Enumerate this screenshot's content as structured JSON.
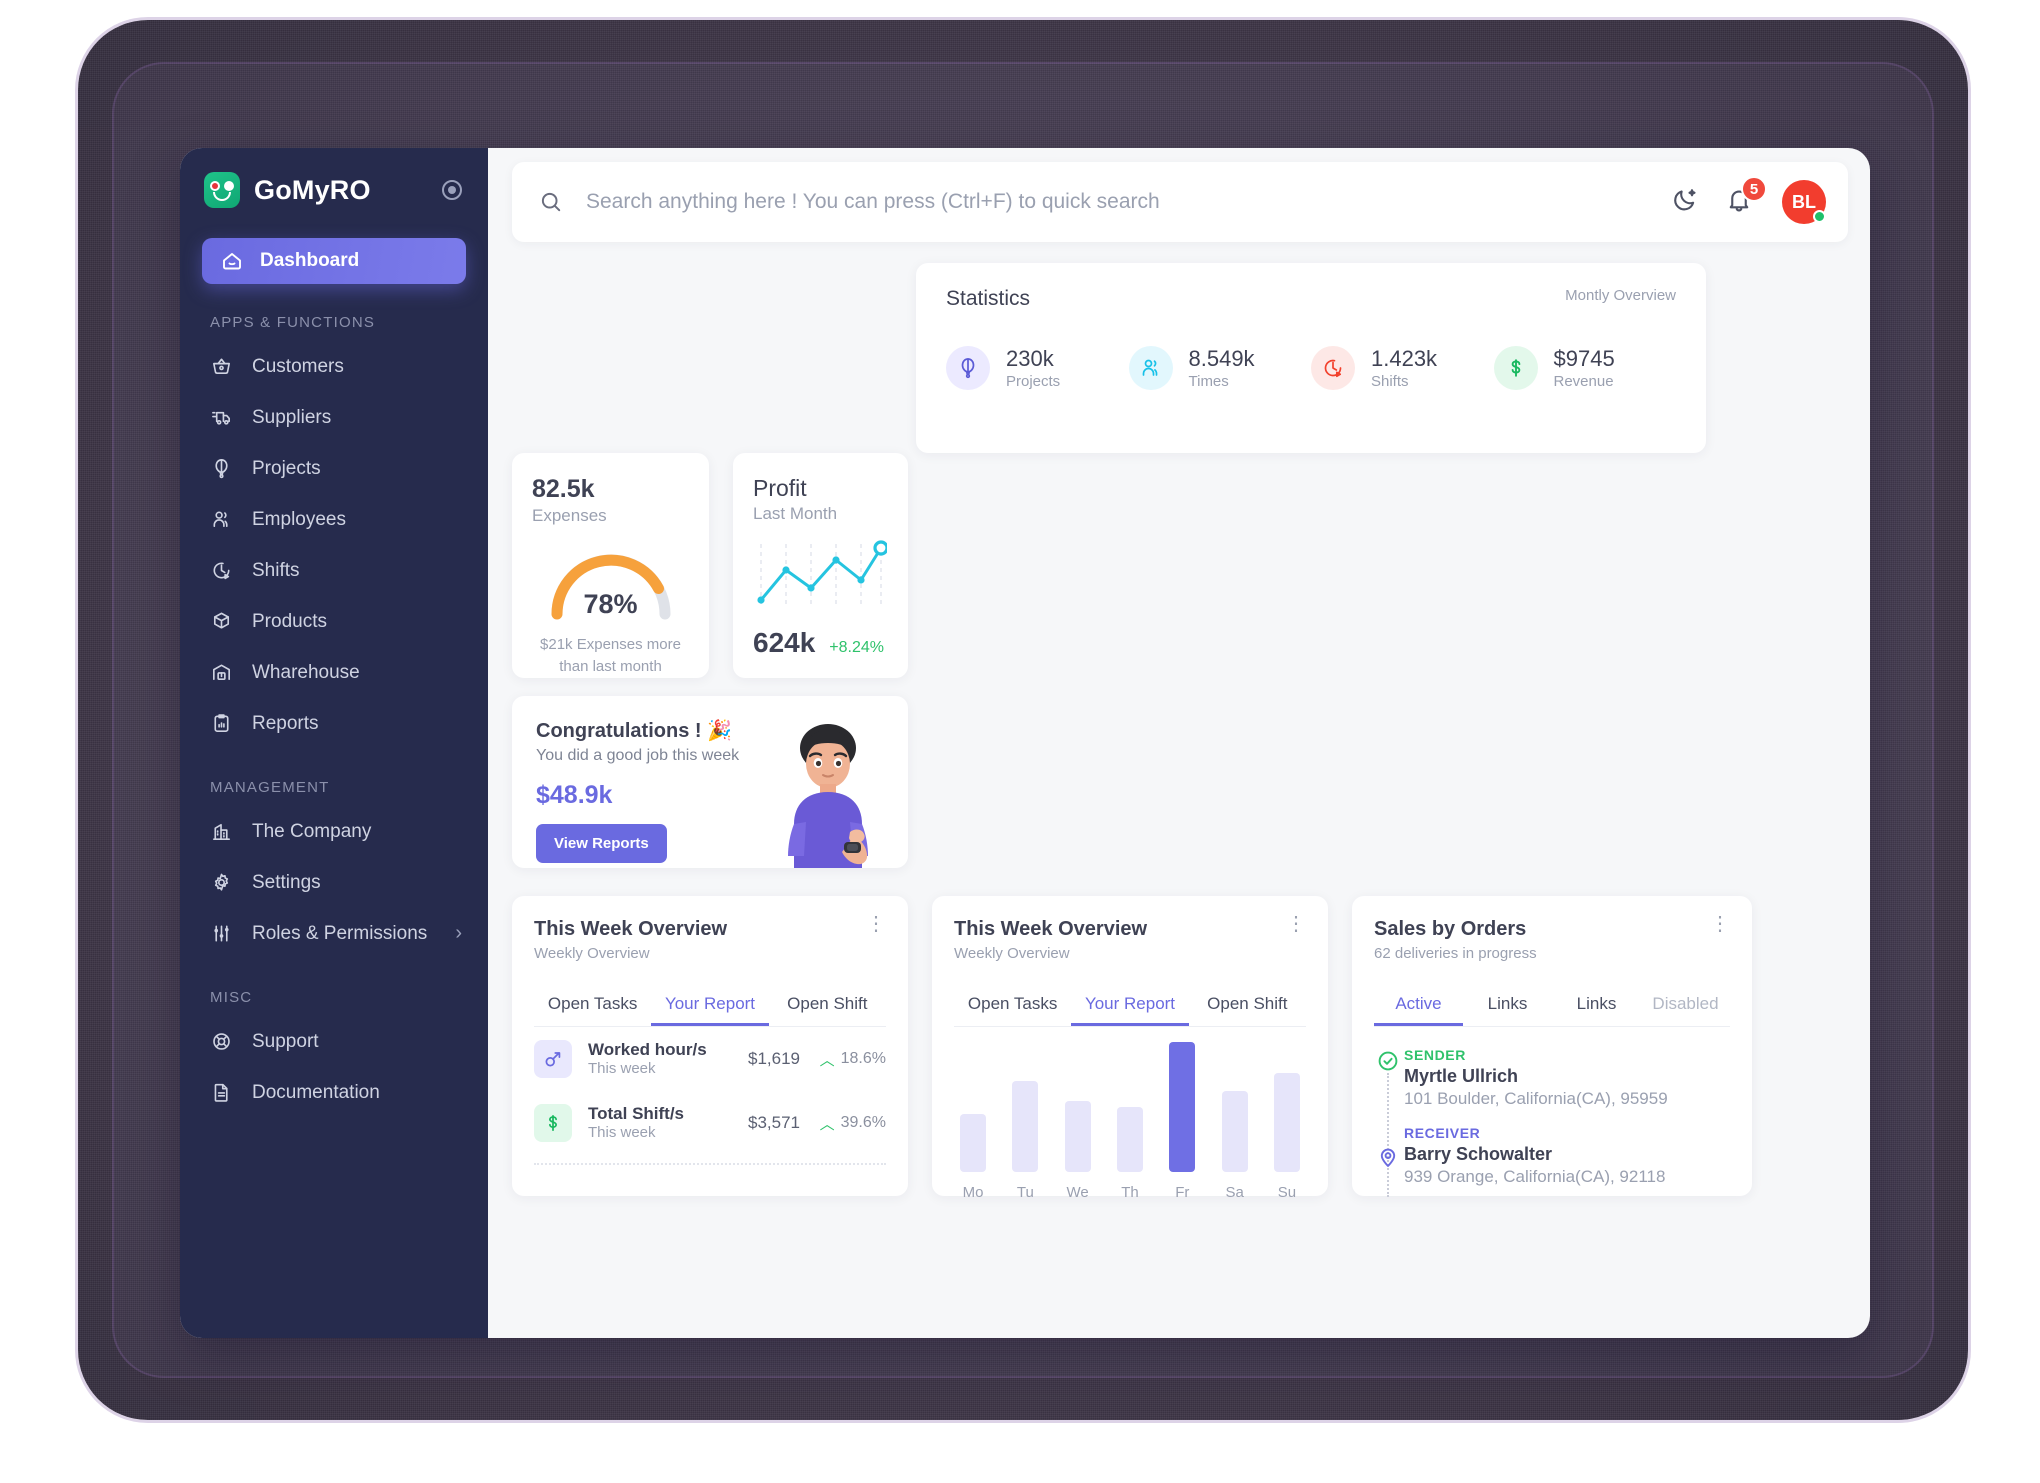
{
  "brand": {
    "name": "GoMyRO",
    "logo_icon": "gomyro-face-logo",
    "collapse_icon": "collapse-toggle-icon"
  },
  "sidebar": {
    "active_item": {
      "label": "Dashboard",
      "icon": "home-icon"
    },
    "sections": [
      {
        "label": "APPS & FUNCTIONS",
        "items": [
          {
            "label": "Customers",
            "icon": "basket-icon"
          },
          {
            "label": "Suppliers",
            "icon": "truck-icon"
          },
          {
            "label": "Projects",
            "icon": "balloon-icon"
          },
          {
            "label": "Employees",
            "icon": "users-icon"
          },
          {
            "label": "Shifts",
            "icon": "clock-play-icon"
          },
          {
            "label": "Products",
            "icon": "box-icon"
          },
          {
            "label": "Wharehouse",
            "icon": "warehouse-icon"
          },
          {
            "label": "Reports",
            "icon": "clipboard-chart-icon"
          }
        ]
      },
      {
        "label": "MANAGEMENT",
        "items": [
          {
            "label": "The Company",
            "icon": "building-icon"
          },
          {
            "label": "Settings",
            "icon": "gear-icon"
          },
          {
            "label": "Roles & Permissions",
            "icon": "sliders-icon",
            "chevron": "›"
          }
        ]
      },
      {
        "label": "MISC",
        "items": [
          {
            "label": "Support",
            "icon": "lifebuoy-icon"
          },
          {
            "label": "Documentation",
            "icon": "document-icon"
          }
        ]
      }
    ]
  },
  "topbar": {
    "search_placeholder": "Search anything here ! You can press (Ctrl+F) to quick search",
    "search_value": "",
    "search_icon": "search-icon",
    "theme_icon": "moon-icon",
    "notifications_icon": "bell-icon",
    "notifications_count": "5",
    "avatar_initials": "BL"
  },
  "statistics": {
    "title": "Statistics",
    "subtitle": "Montly Overview",
    "items": [
      {
        "value": "230k",
        "label": "Projects",
        "icon": "balloon-icon",
        "color": "#5b5bd6",
        "bg": "#eceaff"
      },
      {
        "value": "8.549k",
        "label": "Times",
        "icon": "users-icon",
        "color": "#17c1e8",
        "bg": "#e2f7fd"
      },
      {
        "value": "1.423k",
        "label": "Shifts",
        "icon": "clock-play-icon",
        "color": "#f2402c",
        "bg": "#fde8e6"
      },
      {
        "value": "$9745",
        "label": "Revenue",
        "icon": "dollar-icon",
        "color": "#19b85f",
        "bg": "#e3f8eb"
      }
    ]
  },
  "expenses": {
    "value": "82.5k",
    "label": "Expenses",
    "gauge_percent": "78%",
    "gauge_value": 78,
    "gauge_color": "#f6a13c",
    "note": "$21k Expenses more than last month"
  },
  "profit": {
    "title": "Profit",
    "subtitle": "Last Month",
    "value": "624k",
    "delta": "+8.24%",
    "line_color": "#25c4e0",
    "points": [
      12,
      58,
      28,
      70,
      44,
      92
    ]
  },
  "congrats": {
    "title": "Congratulations ! 🎉",
    "subtitle": "You did a good job this week",
    "amount": "$48.9k",
    "button": "View Reports",
    "illustration": "person-thumbs-up-illustration"
  },
  "week_report": {
    "title": "This Week Overview",
    "subtitle": "Weekly Overview",
    "menu_icon": "kebab-menu-icon",
    "tabs": [
      {
        "label": "Open Tasks",
        "active": false
      },
      {
        "label": "Your Report",
        "active": true
      },
      {
        "label": "Open Shift",
        "active": false
      }
    ],
    "rows": [
      {
        "title": "Worked hour/s",
        "sub": "This week",
        "amount": "$1,619",
        "pct": "18.6%",
        "trend_icon": "arrow-up-icon",
        "icon": "shovel-icon",
        "icon_bg": "#e9e8fd",
        "icon_color": "#6a6ae0"
      },
      {
        "title": "Total Shift/s",
        "sub": "This week",
        "amount": "$3,571",
        "pct": "39.6%",
        "trend_icon": "arrow-up-icon",
        "icon": "dollar-icon",
        "icon_bg": "#e1f8ea",
        "icon_color": "#19b85f"
      }
    ]
  },
  "week_chart": {
    "title": "This Week Overview",
    "subtitle": "Weekly Overview",
    "menu_icon": "kebab-menu-icon",
    "tabs": [
      {
        "label": "Open Tasks",
        "active": false
      },
      {
        "label": "Your Report",
        "active": true
      },
      {
        "label": "Open Shift",
        "active": false
      }
    ]
  },
  "sales": {
    "title": "Sales by Orders",
    "subtitle": "62 deliveries in progress",
    "menu_icon": "kebab-menu-icon",
    "tabs": [
      {
        "label": "Active",
        "active": true,
        "muted": false
      },
      {
        "label": "Links",
        "active": false,
        "muted": false
      },
      {
        "label": "Links",
        "active": false,
        "muted": false
      },
      {
        "label": "Disabled",
        "active": false,
        "muted": true
      }
    ],
    "shipment": [
      {
        "kind": "SENDER",
        "icon": "check-circle-icon",
        "name": "Myrtle Ullrich",
        "address": "101 Boulder, California(CA), 95959"
      },
      {
        "kind": "RECEIVER",
        "icon": "map-pin-icon",
        "name": "Barry Schowalter",
        "address": "939 Orange, California(CA), 92118"
      }
    ]
  },
  "chart_data": {
    "type": "bar",
    "title": "This Week Overview",
    "categories": [
      "Mo",
      "Tu",
      "We",
      "Th",
      "Fr",
      "Sa",
      "Su"
    ],
    "values": [
      45,
      70,
      55,
      50,
      100,
      62,
      76
    ],
    "highlight_index": 4,
    "xlabel": "",
    "ylabel": "",
    "ylim": [
      0,
      100
    ],
    "grid": false,
    "legend": "none",
    "bar_color": "#e6e5fa",
    "highlight_color": "#6f6fe4"
  }
}
